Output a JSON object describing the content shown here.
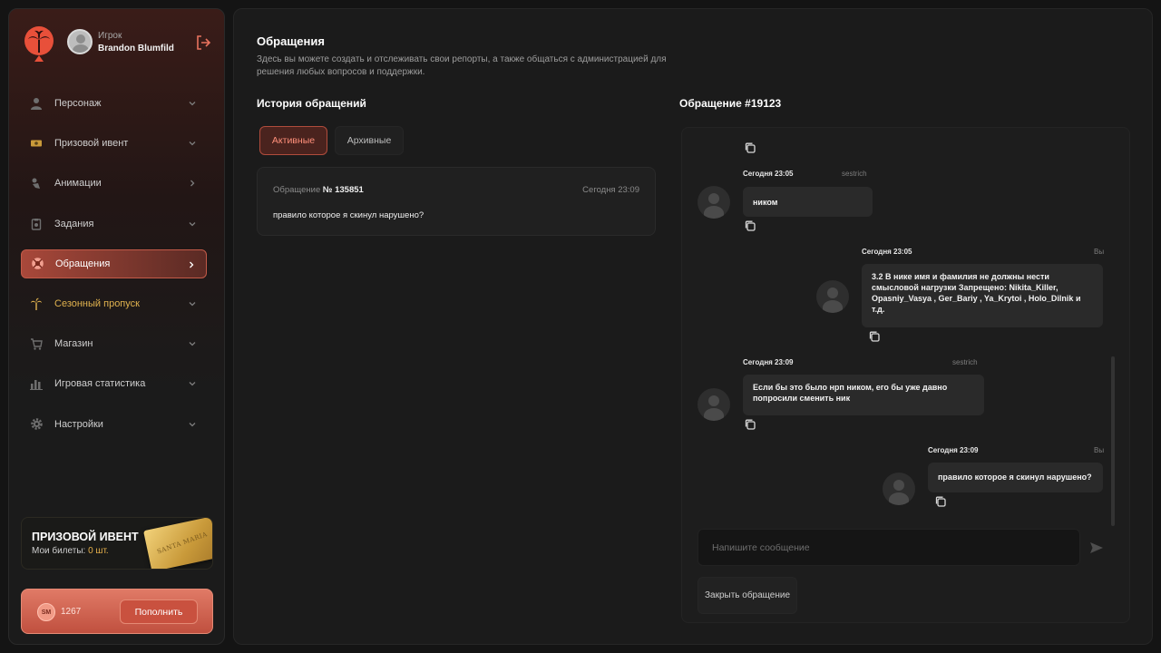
{
  "profile": {
    "role": "Игрок",
    "name": "Brandon Blumfild"
  },
  "nav": {
    "items": [
      {
        "label": "Персонаж",
        "icon": "user-icon"
      },
      {
        "label": "Призовой ивент",
        "icon": "ticket-icon"
      },
      {
        "label": "Анимации",
        "icon": "animation-icon"
      },
      {
        "label": "Задания",
        "icon": "tasks-icon"
      },
      {
        "label": "Обращения",
        "icon": "lifebuoy-icon",
        "active": true
      },
      {
        "label": "Сезонный пропуск",
        "icon": "palm-icon"
      },
      {
        "label": "Магазин",
        "icon": "cart-icon"
      },
      {
        "label": "Игровая статистика",
        "icon": "stats-icon"
      },
      {
        "label": "Настройки",
        "icon": "gear-icon"
      }
    ]
  },
  "event_card": {
    "title": "ПРИЗОВОЙ ИВЕНТ",
    "tickets_label": "Мои билеты:",
    "tickets_value": "0 шт.",
    "ticket_text": "SANTA MARIA"
  },
  "balance": {
    "coin_label": "SM",
    "amount": "1267",
    "topup_label": "Пополнить"
  },
  "page": {
    "title": "Обращения",
    "description": "Здесь вы можете создать и отслеживать свои репорты, а также общаться с администрацией для решения любых вопросов и поддержки."
  },
  "history": {
    "title": "История обращений",
    "tabs": [
      "Активные",
      "Архивные"
    ],
    "tickets": [
      {
        "label": "Обращение",
        "number": "№ 135851",
        "time": "Сегодня 23:09",
        "text": "правило которое я скинул нарушено?"
      }
    ]
  },
  "chat": {
    "title": "Обращение #19123",
    "messages": [
      {
        "time": "Сегодня 23:05",
        "author": "sestrich",
        "text": "ником"
      },
      {
        "time": "Сегодня 23:05",
        "author": "Вы",
        "text": "3.2 В нике имя и фамилия не должны нести смысловой нагрузки Запрещено: Nikita_Killer, Opasniy_Vasya , Ger_Bariy , Ya_Krytoi , Holo_Dilnik и т.д."
      },
      {
        "time": "Сегодня 23:09",
        "author": "sestrich",
        "text": "Если бы это было нрп ником, его бы уже давно попросили сменить ник"
      },
      {
        "time": "Сегодня 23:09",
        "author": "Вы",
        "text": "правило которое я скинул нарушено?"
      }
    ],
    "input_placeholder": "Напишите сообщение",
    "close_label": "Закрыть обращение"
  },
  "colors": {
    "accent": "#c9513f",
    "season": "#e0b24e",
    "background": "#141414",
    "panel": "#1b1b1b"
  }
}
